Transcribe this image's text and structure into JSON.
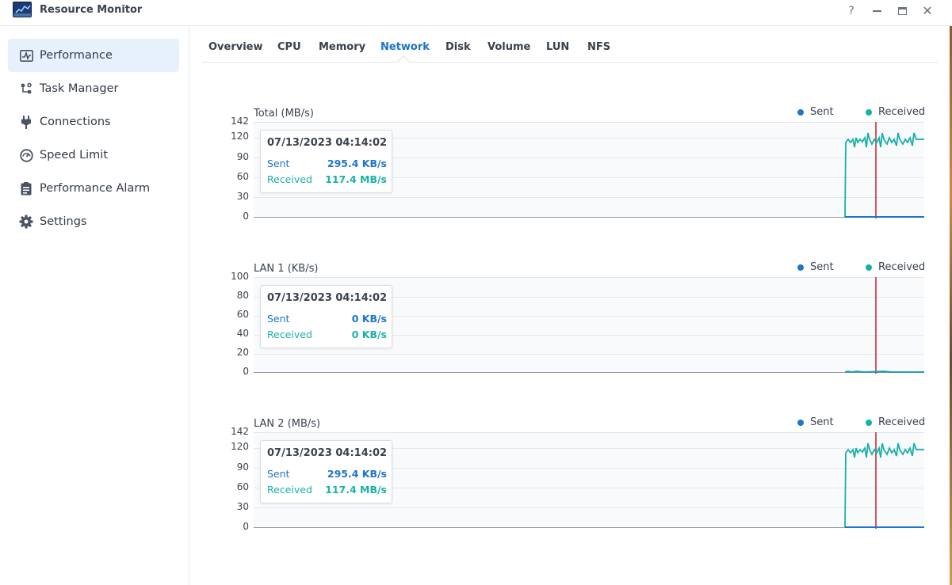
{
  "window": {
    "title": "Resource Monitor",
    "buttons": {
      "help": "?",
      "close": "✕"
    }
  },
  "colors": {
    "accent": "#1c74c9",
    "sent": "#1f74cc",
    "received": "#18b1a8",
    "cursor": "#c7323c",
    "active_bg": "#e6f1fb"
  },
  "sidebar": {
    "items": [
      {
        "label": "Performance",
        "icon": "performance-icon",
        "active": true
      },
      {
        "label": "Task Manager",
        "icon": "task-manager-icon",
        "active": false
      },
      {
        "label": "Connections",
        "icon": "plug-icon",
        "active": false
      },
      {
        "label": "Speed Limit",
        "icon": "gauge-icon",
        "active": false
      },
      {
        "label": "Performance Alarm",
        "icon": "alarm-icon",
        "active": false
      },
      {
        "label": "Settings",
        "icon": "gear-icon",
        "active": false
      }
    ]
  },
  "tabs": [
    {
      "label": "Overview"
    },
    {
      "label": "CPU"
    },
    {
      "label": "Memory"
    },
    {
      "label": "Network",
      "active": true
    },
    {
      "label": "Disk"
    },
    {
      "label": "Volume"
    },
    {
      "label": "LUN"
    },
    {
      "label": "NFS"
    }
  ],
  "charts": [
    {
      "title": "Total (MB/s)",
      "legend": {
        "sent": "Sent",
        "received": "Received"
      },
      "ticks": [
        "142",
        "120",
        "90",
        "60",
        "30",
        "0"
      ],
      "tooltip": {
        "time": "07/13/2023 04:14:02",
        "sent_label": "Sent",
        "sent_value": "295.4 KB/s",
        "received_label": "Received",
        "received_value": "117.4 MB/s"
      }
    },
    {
      "title": "LAN 1 (KB/s)",
      "legend": {
        "sent": "Sent",
        "received": "Received"
      },
      "ticks": [
        "100",
        "80",
        "60",
        "40",
        "20",
        "0"
      ],
      "tooltip": {
        "time": "07/13/2023 04:14:02",
        "sent_label": "Sent",
        "sent_value": "0 KB/s",
        "received_label": "Received",
        "received_value": "0 KB/s"
      }
    },
    {
      "title": "LAN 2 (MB/s)",
      "legend": {
        "sent": "Sent",
        "received": "Received"
      },
      "ticks": [
        "142",
        "120",
        "90",
        "60",
        "30",
        "0"
      ],
      "tooltip": {
        "time": "07/13/2023 04:14:02",
        "sent_label": "Sent",
        "sent_value": "295.4 KB/s",
        "received_label": "Received",
        "received_value": "117.4 MB/s"
      }
    }
  ]
}
